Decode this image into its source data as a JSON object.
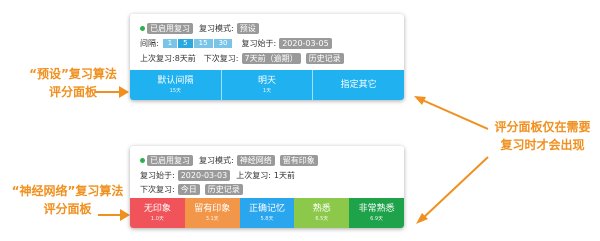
{
  "annotations": {
    "preset_label_1": "“预设”复习算法",
    "preset_label_2": "评分面板",
    "neural_label_1": "“神经网络”复习算法",
    "neural_label_2": "评分面板",
    "note_1": "评分面板仅在需要",
    "note_2": "复习时才会出现"
  },
  "panel1": {
    "status": "已启用复习",
    "mode_label": "复习模式:",
    "mode_value": "预设",
    "interval_label": "间隔:",
    "intervals": [
      "1",
      "5",
      "15",
      "30"
    ],
    "start_label": "复习始于:",
    "start_value": "2020-03-05",
    "last_label": "上次复习:",
    "last_value": "8天前",
    "next_label": "下次复习:",
    "next_value": "7天前（逾期）",
    "history": "历史记录",
    "buttons": [
      {
        "label": "默认间隔",
        "sub": "15天"
      },
      {
        "label": "明天",
        "sub": "1天"
      },
      {
        "label": "指定其它",
        "sub": ""
      }
    ],
    "button_color": "#1fb1f0"
  },
  "panel2": {
    "status": "已启用复习",
    "mode_label": "复习模式:",
    "mode_value": "神经网络",
    "keep_tag": "留有印象",
    "start_label": "复习始于:",
    "start_value": "2020-03-03",
    "last_label": "上次复习:",
    "last_value": "1天前",
    "next_label": "下次复习:",
    "next_value": "今日",
    "history": "历史记录",
    "buttons": [
      {
        "label": "无印象",
        "sub": "1.0天",
        "color": "#f0545a"
      },
      {
        "label": "留有印象",
        "sub": "3.1天",
        "color": "#f2964a"
      },
      {
        "label": "正确记忆",
        "sub": "5.8天",
        "color": "#2aa6ee"
      },
      {
        "label": "熟悉",
        "sub": "6.5天",
        "color": "#8cc94a"
      },
      {
        "label": "非常熟悉",
        "sub": "6.9天",
        "color": "#1ea24a"
      }
    ]
  }
}
